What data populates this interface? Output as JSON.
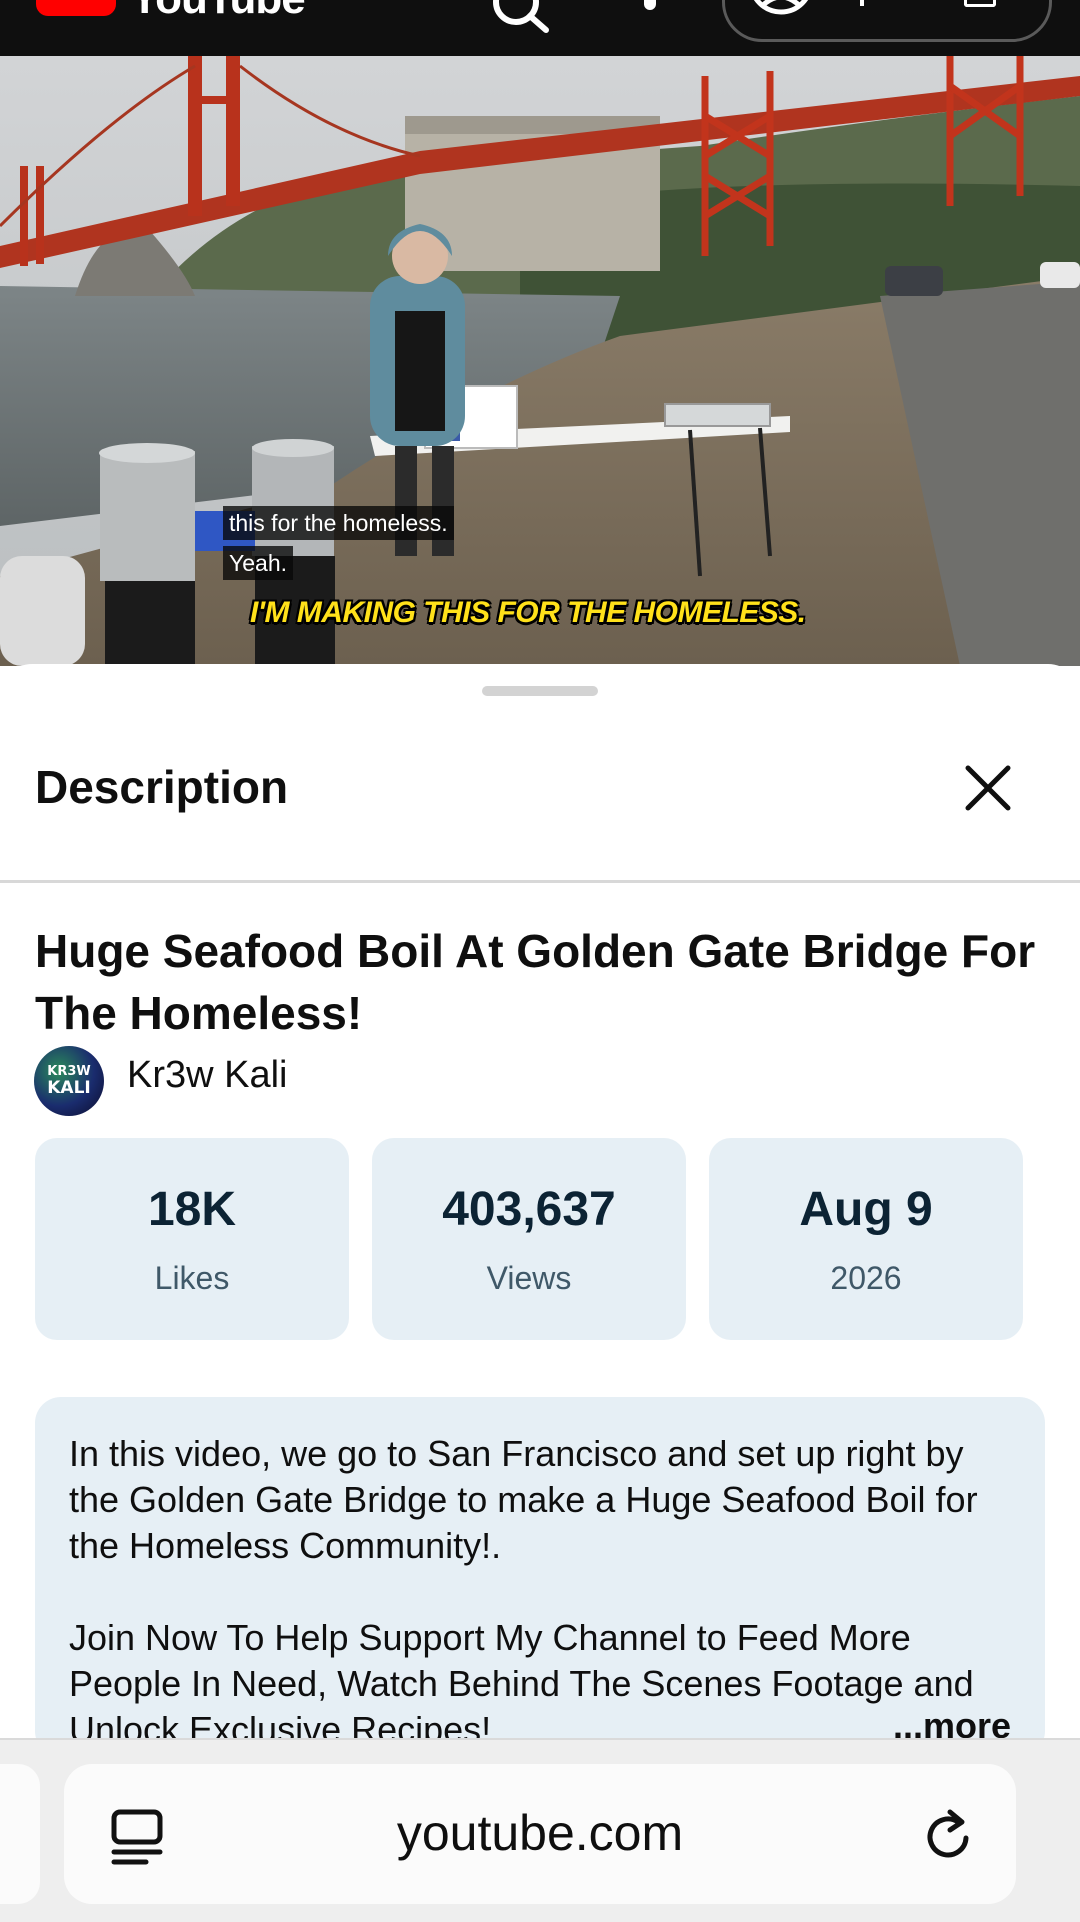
{
  "app": {
    "name": "YouTube"
  },
  "video": {
    "captions": [
      "this for the homeless.",
      "Yeah."
    ],
    "burned_subtitle": "I'M MAKING THIS FOR THE HOMELESS."
  },
  "sheet": {
    "title": "Description",
    "video_title": "Huge Seafood Boil At Golden Gate Bridge For The Homeless!",
    "channel": {
      "name": "Kr3w Kali",
      "avatar_text_top": "KR3W",
      "avatar_text_bottom": "KALI"
    },
    "stats": [
      {
        "value": "18K",
        "label": "Likes"
      },
      {
        "value": "403,637",
        "label": "Views"
      },
      {
        "value": "Aug 9",
        "label": "2026"
      }
    ],
    "description": {
      "paragraphs": [
        "In this video, we go to San Francisco and set up right by the Golden Gate Bridge to make a Huge Seafood Boil for the Homeless Community!.",
        "Join Now To Help Support My Channel to Feed More People In Need, Watch Behind The Scenes Footage and Unlock Exclusive Recipes!"
      ],
      "more_label": "...more"
    }
  },
  "browser": {
    "url": "youtube.com"
  },
  "icons": {
    "search": "search-icon",
    "more": "more-vert-icon",
    "account": "account-icon",
    "close": "close-icon",
    "page": "page-info-icon",
    "reload": "reload-icon"
  },
  "colors": {
    "brand_red": "#ff0000",
    "stat_bg": "#e6eff5",
    "subtitle_yellow": "#ffe11a"
  }
}
